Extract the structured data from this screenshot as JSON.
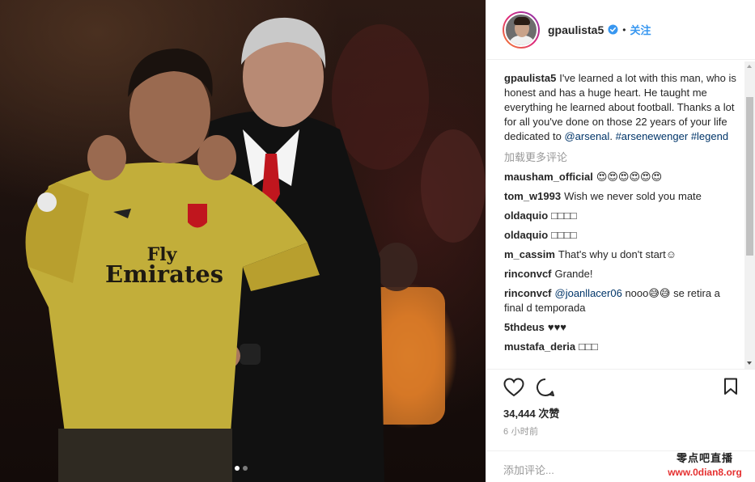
{
  "post": {
    "username": "gpaulista5",
    "separator": "•",
    "follow_label": "关注",
    "caption": {
      "username": "gpaulista5",
      "text": "I've learned a lot with this man, who is honest and has a huge heart. He taught me everything he learned about football. Thanks a lot for all you've done on those 22 years of your life dedicated to",
      "mention": "@arsenal",
      "after_mention": ".",
      "hashtag1": "#arsenewenger",
      "hashtag2": "#legend"
    },
    "load_more_label": "加载更多评论",
    "comments": [
      {
        "user": "mausham_official",
        "text": "😍😍😍😍😍😍"
      },
      {
        "user": "tom_w1993",
        "text": "Wish we never sold you mate"
      },
      {
        "user": "oldaquio",
        "text": "□□□□"
      },
      {
        "user": "oldaquio",
        "text": "□□□□"
      },
      {
        "user": "m_cassim",
        "text": "That's why u don't start☺"
      },
      {
        "user": "rinconvcf",
        "text": "Grande!"
      },
      {
        "user": "rinconvcf",
        "mention": "@joanllacer06",
        "text": "nooo😅😅 se retira a final d temporada"
      },
      {
        "user": "5thdeus",
        "text": "♥♥♥"
      },
      {
        "user": "mustafa_deria",
        "text": "□□□"
      }
    ],
    "likes": "34,444 次赞",
    "time": "6 小时前",
    "add_comment_placeholder": "添加评论...",
    "carousel": {
      "count": 2,
      "active": 0
    }
  },
  "photo": {
    "jersey_sponsor_line1": "Fly",
    "jersey_sponsor_line2": "Emirates"
  },
  "watermark": {
    "line1": "零点吧直播",
    "line2": "www.0dian8.org"
  },
  "colors": {
    "link": "#003569",
    "accent": "#3897f0",
    "muted": "#999999",
    "watermark_red": "#e53030"
  }
}
